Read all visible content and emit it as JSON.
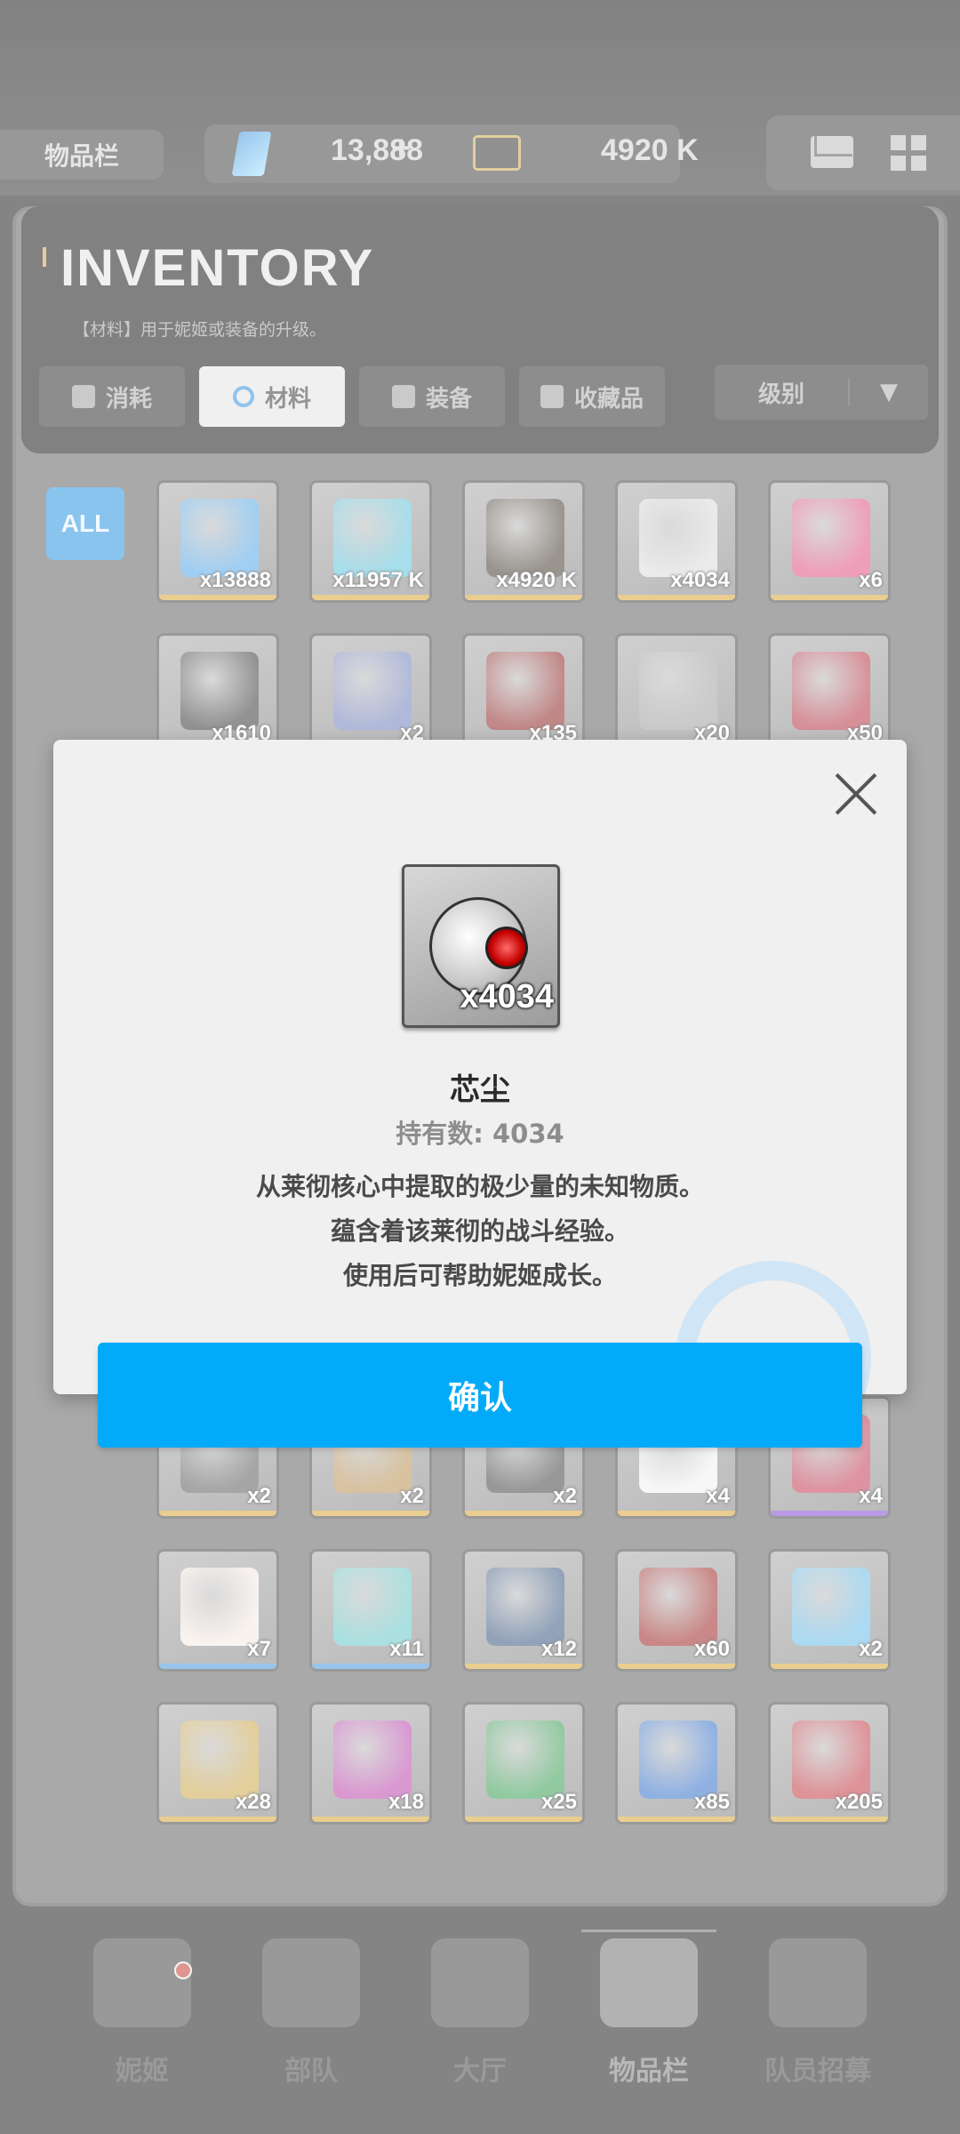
{
  "top_bar": {
    "title": "物品栏",
    "gems": "13,888",
    "plus": "+",
    "credits": "4920 K"
  },
  "inventory": {
    "title": "INVENTORY",
    "subtitle": "【材料】用于妮姬或装备的升级。",
    "tabs": [
      {
        "label": "消耗"
      },
      {
        "label": "材料"
      },
      {
        "label": "装备"
      },
      {
        "label": "收藏品"
      }
    ],
    "sort_label": "级别",
    "sort_arrow": "▼",
    "all_label": "ALL",
    "rows": [
      [
        {
          "count": "x13888",
          "color": "#4aa3e8"
        },
        {
          "count": "x11957 K",
          "color": "#56c0d8"
        },
        {
          "count": "x4920 K",
          "color": "#3c3226"
        },
        {
          "count": "x4034",
          "color": "#d8d8d8"
        },
        {
          "count": "x6",
          "color": "#e0457a"
        }
      ],
      [
        {
          "count": "x1610",
          "color": "#2f2f2f"
        },
        {
          "count": "x2",
          "color": "#6a7ab8"
        },
        {
          "count": "x135",
          "color": "#8a1a1a"
        },
        {
          "count": "x20",
          "color": "#9a9a9a"
        },
        {
          "count": "x50",
          "color": "#b22a3a"
        }
      ],
      [
        {
          "count": "x2",
          "color": "#555555"
        },
        {
          "count": "x2",
          "color": "#b58a4a"
        },
        {
          "count": "x2",
          "color": "#3a3a3a"
        },
        {
          "count": "x4",
          "color": "#f0f0f0"
        },
        {
          "count": "x4",
          "color": "#c0304a"
        }
      ],
      [
        {
          "count": "x7",
          "color": "#f3e8e0"
        },
        {
          "count": "x11",
          "color": "#5fc4c4"
        },
        {
          "count": "x12",
          "color": "#2e4e7a"
        },
        {
          "count": "x60",
          "color": "#9a1a1a"
        },
        {
          "count": "x2",
          "color": "#5fb8e6"
        }
      ],
      [
        {
          "count": "x28",
          "color": "#caa340"
        },
        {
          "count": "x18",
          "color": "#b83aa8"
        },
        {
          "count": "x25",
          "color": "#2e9a4a"
        },
        {
          "count": "x85",
          "color": "#2a6ac8"
        },
        {
          "count": "x205",
          "color": "#c0303a"
        }
      ]
    ]
  },
  "bottom_nav": [
    {
      "label": "妮姬"
    },
    {
      "label": "部队"
    },
    {
      "label": "大厅"
    },
    {
      "label": "物品栏"
    },
    {
      "label": "队员招募"
    }
  ],
  "modal": {
    "item_count": "x4034",
    "name": "芯尘",
    "owned": "持有数: 4034",
    "description": [
      "从莱彻核心中提取的极少量的未知物质。",
      "蕴含着该莱彻的战斗经验。",
      "使用后可帮助妮姬成长。"
    ],
    "confirm_label": "确认"
  },
  "colors": {
    "accent": "#03aaf9",
    "tab_active_icon": "#2b8fe0"
  }
}
